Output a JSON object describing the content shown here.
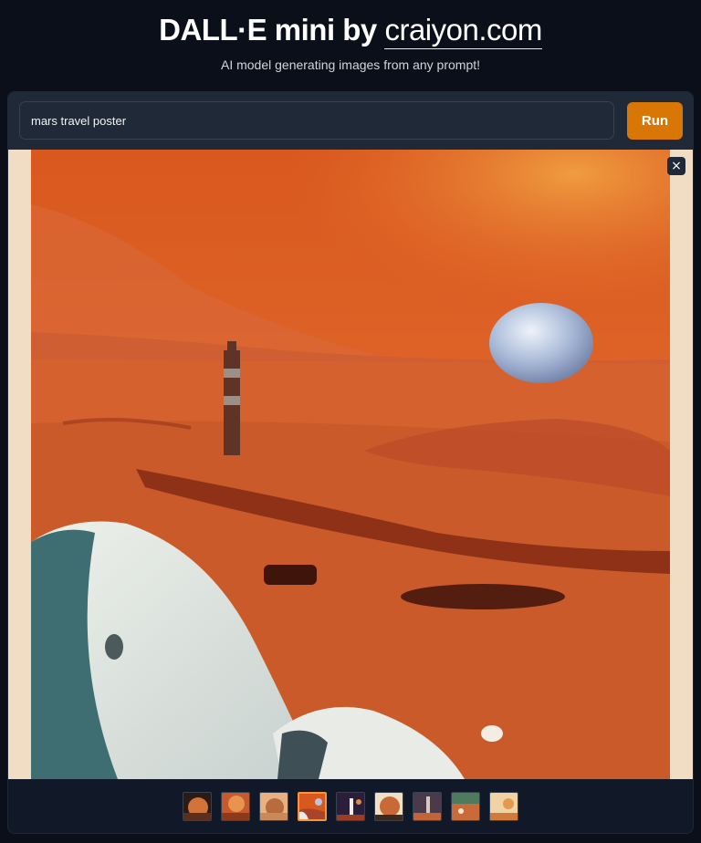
{
  "header": {
    "title_prefix": "DALL·E mini by ",
    "title_link": "craiyon.com",
    "subtitle": "AI model generating images from any prompt!"
  },
  "prompt": {
    "value": "mars travel poster"
  },
  "run_button": {
    "label": "Run"
  },
  "close_button": {
    "label": "×"
  },
  "gallery": {
    "thumbnail_count": 9,
    "selected_index": 3
  },
  "colors": {
    "accent": "#d97706",
    "background": "#0b0f19",
    "panel": "#111827"
  }
}
